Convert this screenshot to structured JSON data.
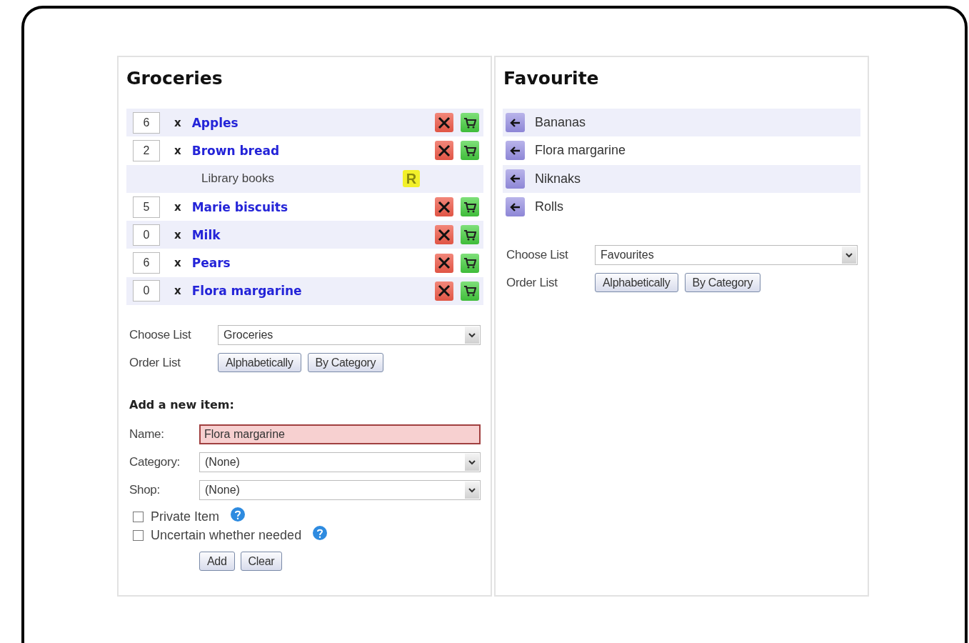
{
  "panels": [
    {
      "title": "Groceries",
      "items": [
        {
          "kind": "item",
          "quantity": "6",
          "times": "x",
          "name": "Apples"
        },
        {
          "kind": "item",
          "quantity": "2",
          "times": "x",
          "name": "Brown bread"
        },
        {
          "kind": "reminder",
          "name": "Library books",
          "badge": "R"
        },
        {
          "kind": "item",
          "quantity": "5",
          "times": "x",
          "name": "Marie biscuits"
        },
        {
          "kind": "item",
          "quantity": "0",
          "times": "x",
          "name": "Milk"
        },
        {
          "kind": "item",
          "quantity": "6",
          "times": "x",
          "name": "Pears"
        },
        {
          "kind": "item",
          "quantity": "0",
          "times": "x",
          "name": "Flora margarine"
        }
      ],
      "choose_list": {
        "label": "Choose List",
        "value": "Groceries"
      },
      "order_list": {
        "label": "Order List",
        "buttons": [
          "Alphabetically",
          "By Category"
        ]
      },
      "add_form": {
        "heading": "Add a new item:",
        "fields": [
          {
            "kind": "text",
            "label": "Name:",
            "value": "Flora margarine",
            "invalid": true
          },
          {
            "kind": "select",
            "label": "Category:",
            "value": "(None)"
          },
          {
            "kind": "select",
            "label": "Shop:",
            "value": "(None)"
          }
        ],
        "checkboxes": [
          {
            "label": "Private Item",
            "checked": false
          },
          {
            "label": "Uncertain whether needed",
            "checked": false
          }
        ],
        "buttons": [
          "Add",
          "Clear"
        ]
      }
    },
    {
      "title": "Favourite",
      "items": [
        {
          "kind": "favourite",
          "name": "Bananas"
        },
        {
          "kind": "favourite",
          "name": "Flora margarine"
        },
        {
          "kind": "favourite",
          "name": "Niknaks"
        },
        {
          "kind": "favourite",
          "name": "Rolls"
        }
      ],
      "choose_list": {
        "label": "Choose List",
        "value": "Favourites"
      },
      "order_list": {
        "label": "Order List",
        "buttons": [
          "Alphabetically",
          "By Category"
        ]
      }
    }
  ]
}
